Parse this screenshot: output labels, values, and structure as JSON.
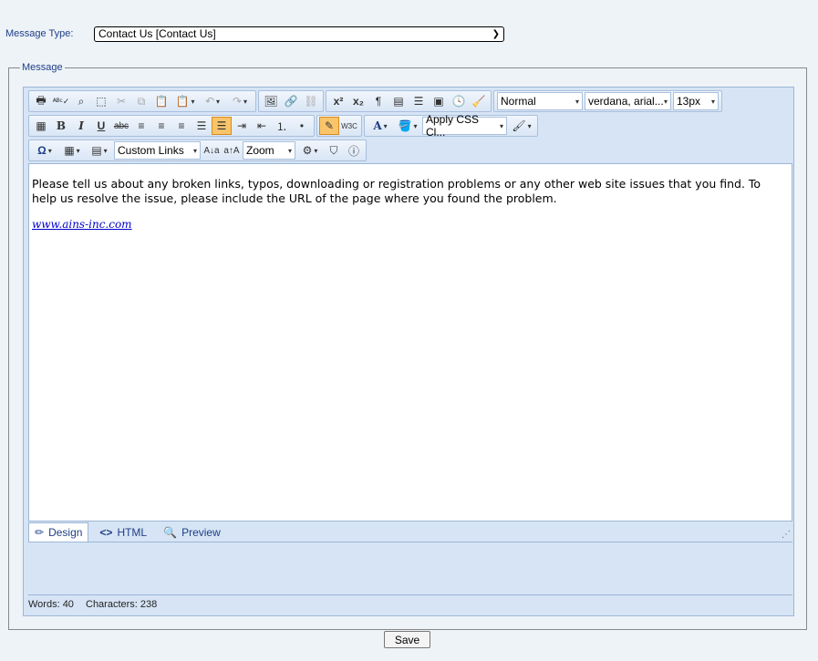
{
  "form": {
    "type_label": "Message Type:",
    "type_value": "Contact Us [Contact Us]",
    "legend": "Message",
    "save_label": "Save"
  },
  "toolbar": {
    "paragraph_style": "Normal",
    "font_name": "verdana, arial...",
    "font_size": "13px",
    "css_class": "Apply CSS Cl...",
    "custom_links": "Custom Links",
    "zoom": "Zoom"
  },
  "content": {
    "paragraph": "Please tell us about any broken links, typos, downloading or registration problems or any other web site issues that you find. To help us resolve the issue, please include the URL of the page where you found the problem.",
    "link": "www.ains-inc.com"
  },
  "modes": {
    "design": "Design",
    "html": "HTML",
    "preview": "Preview"
  },
  "status": {
    "words": "Words: 40",
    "characters": "Characters: 238"
  },
  "colors": {
    "accent": "#1f3f86",
    "editor_bg": "#d6e4f5",
    "active_tool": "#f9c56b"
  }
}
